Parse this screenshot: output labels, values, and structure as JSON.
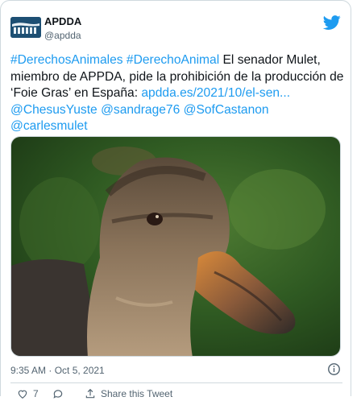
{
  "account": {
    "name": "APDDA",
    "handle": "@apdda",
    "avatar_text": "APDDA"
  },
  "tweet": {
    "hashtag1": "#DerechosAnimales",
    "hashtag2": "#DerechoAnimal",
    "text1": " El senador Mulet, miembro de APPDA, pide la prohibición de la producción de ‘Foie Gras’ en España: ",
    "link": "apdda.es/2021/10/el-sen...",
    "mention1": "@ChesusYuste",
    "mention2": "@sandrage76",
    "mention3": "@SofCastanon",
    "mention4": "@carlesmulet"
  },
  "meta": {
    "timestamp": "9:35 AM · Oct 5, 2021"
  },
  "actions": {
    "like_count": "7",
    "share_label": "Share this Tweet"
  },
  "colors": {
    "link": "#1d9bf0",
    "avatar_bg": "#1d4f73",
    "twitter_blue": "#1d9bf0"
  }
}
